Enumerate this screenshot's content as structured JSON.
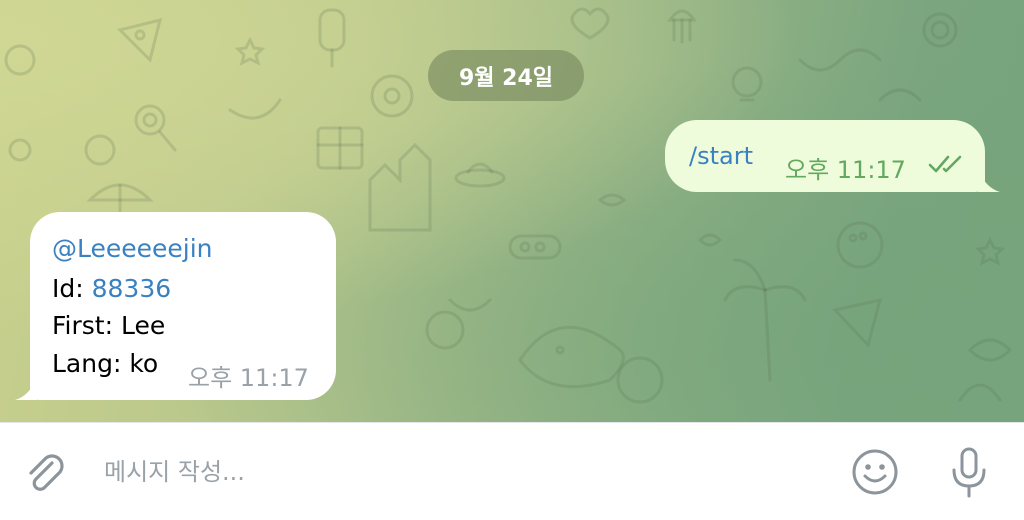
{
  "chat": {
    "date_label": "9월 24일",
    "outgoing": {
      "text": "/start",
      "time": "오후 11:17",
      "status_icon": "double-check-icon"
    },
    "incoming": {
      "username": "@Leeeeeejin",
      "id_label": "Id: ",
      "id_value": "88336",
      "first_line": "First: Lee",
      "lang_line": "Lang: ko",
      "time": "오후 11:17"
    }
  },
  "composer": {
    "placeholder": "메시지 작성...",
    "attach_icon": "paperclip-icon",
    "emoji_icon": "smiley-icon",
    "mic_icon": "microphone-icon"
  },
  "colors": {
    "outgoing_bubble": "#effcdc",
    "incoming_bubble": "#ffffff",
    "link": "#3a81c1",
    "outgoing_meta": "#62a95f",
    "incoming_meta": "#9aa2a9",
    "icon_gray": "#8c959c"
  }
}
